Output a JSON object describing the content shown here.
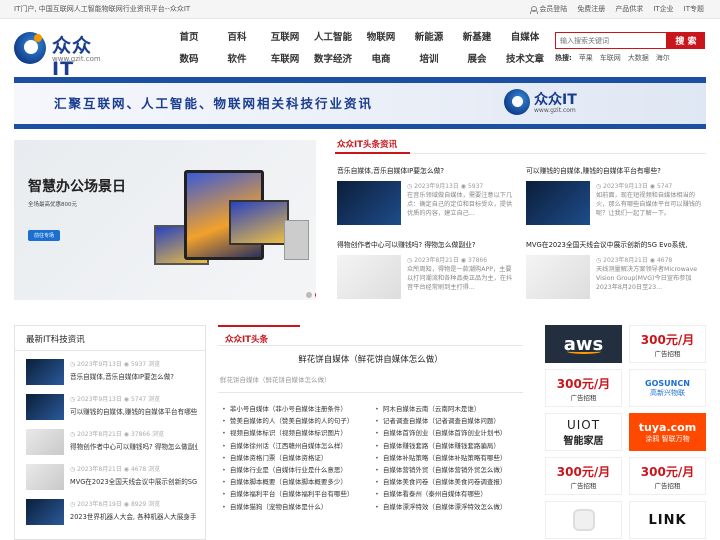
{
  "topbar": {
    "slogan": "IT门户, 中国互联网人工智能物联网行业资讯平台--众众IT",
    "links": [
      "会员登陆",
      "免费注册",
      "产品供求",
      "IT企业",
      "IT专题"
    ]
  },
  "logo": {
    "name": "众众IT",
    "url": "www.gzit.com"
  },
  "nav": [
    "首页",
    "百科",
    "互联网",
    "人工智能",
    "物联网",
    "新能源",
    "新基建",
    "自媒体",
    "数码",
    "软件",
    "车联网",
    "数字经济",
    "电商",
    "培训",
    "展会",
    "技术文章"
  ],
  "search": {
    "placeholder": "输入搜索关键词",
    "button": "搜 索"
  },
  "hot": {
    "label": "热搜:",
    "items": [
      "苹果",
      "车联网",
      "大数据",
      "海尔"
    ]
  },
  "banner": {
    "text": "汇聚互联网、人工智能、物联网相关科技行业资讯",
    "logo_name": "众众IT",
    "logo_url": "www.gzit.com"
  },
  "slide": {
    "title": "智慧办公场景日",
    "subtitle": "全场最高优惠800元",
    "button": "前往专场"
  },
  "headlines": {
    "title": "众众IT头条资讯",
    "cards": [
      {
        "title": "音乐自媒体,音乐自媒体IP要怎么做?",
        "date": "2023年9月13日",
        "views": "5937",
        "desc": "在音乐领域做自媒体，需要注意以下几点：确定自己的定位和目标受众，提供优质的内容，建立自己..."
      },
      {
        "title": "可以赚钱的自媒体,赚钱的自媒体平台有哪些?",
        "date": "2023年9月13日",
        "views": "5747",
        "desc": "如前面，现在短视频和自媒体相当的火，那么有哪些自媒体平台可以赚钱的呢？让我们一起了解一下。"
      },
      {
        "title": "得物创作者中心可以赚钱吗? 得物怎么做副业?",
        "date": "2023年8月21日",
        "views": "37866",
        "desc": "众所周知，得物是一款潮购APP，主要以打问潮流和各种品类正品为主，在抖音平台经常刷到主打得..."
      },
      {
        "title": "MVG在2023全国天线会议中展示创新的SG Evo系统,",
        "date": "2023年8月21日",
        "views": "4678",
        "desc": "天线测量解决方案领导者Microwave Vision Group(MVG)今日宣布参加2023年8月20日至23..."
      }
    ]
  },
  "latest": {
    "title": "最新IT科技资讯",
    "items": [
      {
        "date": "2023年9月13日",
        "views": "5937 浏览",
        "title": "音乐自媒体,音乐自媒体IP要怎么做?"
      },
      {
        "date": "2023年9月13日",
        "views": "5747 浏览",
        "title": "可以赚钱的自媒体,赚钱的自媒体平台有哪些"
      },
      {
        "date": "2023年8月21日",
        "views": "37866 浏览",
        "title": "得物创作者中心可以赚钱吗? 得物怎么做副业"
      },
      {
        "date": "2023年8月21日",
        "views": "4678 浏览",
        "title": "MVG在2023全国天线会议中展示创新的SG Evo"
      },
      {
        "date": "2023年8月19日",
        "views": "8929 浏览",
        "title": "2023世界机器人大会, 各种机器人大展身手"
      }
    ]
  },
  "article": {
    "tag": "众众IT头条",
    "title": "鲜花饼自媒体（鲜花饼自媒体怎么做）",
    "subtitle": "鲜花饼自媒体（鲜花饼自媒体怎么做）",
    "left_links": [
      "菲小号自媒体（菲小号自媒体注册条件）",
      "赞美自媒体的人（赞美自媒体的人的句子）",
      "视频自媒体标识（视频自媒体标识图片）",
      "自媒体徐州话（江西赣州自媒体怎么样）",
      "自媒体资格门票（自媒体资格证）",
      "自媒体行业是（自媒体行业是什么意思）",
      "自媒体脚本概要（自媒体脚本概要多少）",
      "自媒体福利平台（自媒体福利平台有哪些）",
      "自媒体猫狗（宠物自媒体是什么）"
    ],
    "right_links": [
      "阿木自媒体云南（云南阿木是谁）",
      "记者调查自媒体（记者调查自媒体问题）",
      "自媒体首饰创业（自媒体首饰创业计划书）",
      "自媒体赚钱套路（自媒体赚钱套路骗局）",
      "自媒体补贴策略（自媒体补贴策略有哪些）",
      "自媒体营销外贸（自媒体营销外贸怎么做）",
      "自媒体美食问卷（自媒体美食问卷调查报）",
      "自媒体看泰州（泰州自媒体有哪些）",
      "自媒体漂浮特效（自媒体漂浮特效怎么做）"
    ]
  },
  "ads": {
    "aws": "aws",
    "price": "300元/月",
    "price_sub": "广告招租",
    "gosuncn_top": "GOSUNCN",
    "gosuncn_bottom": "高新兴物联",
    "uiot_top": "UIOT",
    "uiot_bottom": "智能家居",
    "tuya_top": "tuya.com",
    "tuya_bottom": "涂鸦 智联万物",
    "link": "LINK"
  }
}
